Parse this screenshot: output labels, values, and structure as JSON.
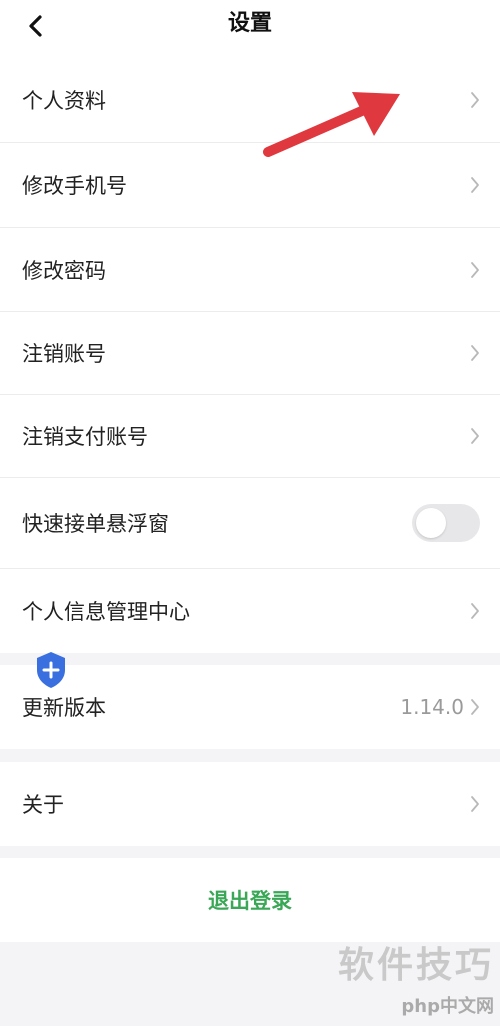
{
  "header": {
    "title": "设置",
    "back_icon": "chevron-left-icon"
  },
  "settings": {
    "profile": "个人资料",
    "change_phone": "修改手机号",
    "change_password": "修改密码",
    "cancel_account": "注销账号",
    "cancel_payment_account": "注销支付账号",
    "quick_order_float": "快速接单悬浮窗",
    "quick_order_float_enabled": false,
    "privacy_center": "个人信息管理中心",
    "update_version": "更新版本",
    "version_value": "1.14.0",
    "about": "关于"
  },
  "actions": {
    "logout": "退出登录"
  },
  "colors": {
    "accent": "#3aa757",
    "arrow": "#e0383f",
    "shield": "#3a6fe0"
  },
  "watermark": {
    "main": "软件技巧",
    "sub": "php中文网"
  }
}
